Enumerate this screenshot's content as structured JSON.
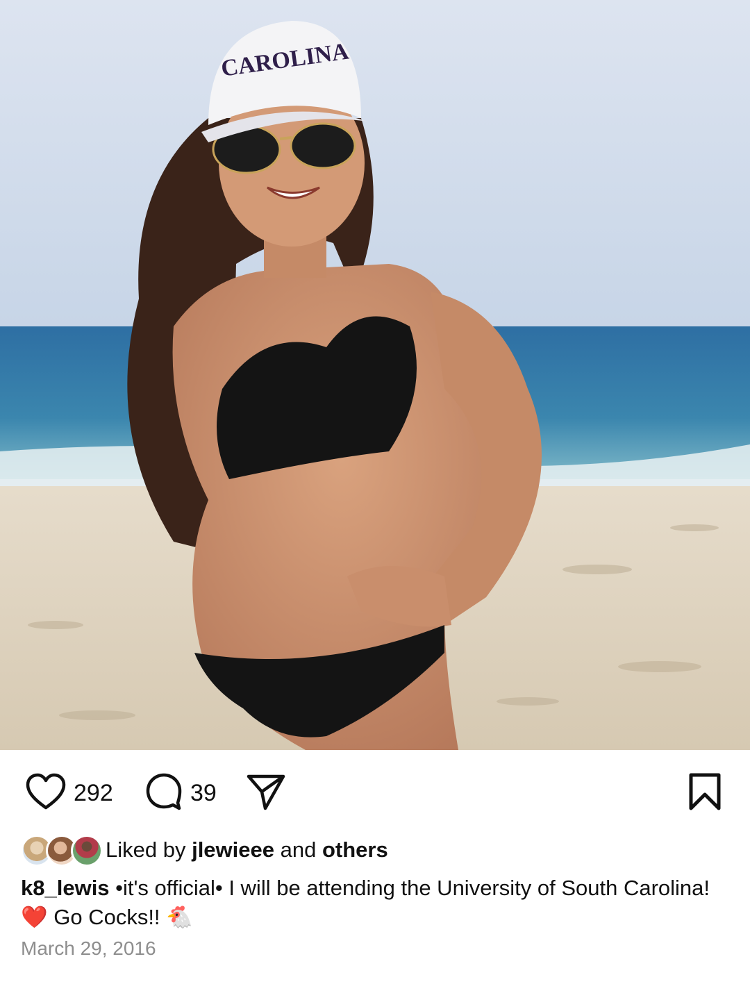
{
  "post": {
    "photo": {
      "subject": "photo",
      "hat_text": "CAROLINA"
    },
    "actions": {
      "like_count": "292",
      "comment_count": "39",
      "icons": [
        "heart-icon",
        "comment-icon",
        "share-icon",
        "bookmark-icon"
      ]
    },
    "likes": {
      "prefix": "Liked by ",
      "user": "jlewieee",
      "middle": " and ",
      "others": "others"
    },
    "caption": {
      "username": "k8_lewis",
      "text_1": " •it's official• I will be attending the University of South Carolina!",
      "emoji_heart": "❤️",
      "text_2": " Go Cocks!! ",
      "emoji_chicken": "🐔"
    },
    "date": "March 29, 2016"
  },
  "colors": {
    "secondary_text": "#8e8e8e",
    "icon": "#111111",
    "heart": "#e0245e"
  }
}
